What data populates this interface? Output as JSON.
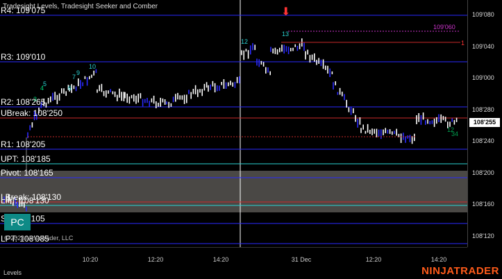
{
  "chart": {
    "indicator_title": "Tradesight Levels, Tradesight Seeker and Comber",
    "pc_label": "PC",
    "copyright": "© 2023 NinjaTrader, LLC",
    "last_price": "108'255"
  },
  "levels": [
    {
      "label": "R4: 109'075",
      "price": 109.235,
      "color": "#2a2aff"
    },
    {
      "label": "R3: 109'010",
      "price": 109.03,
      "color": "#2a2aff"
    },
    {
      "label": "R2: 108'265",
      "price": 108.828,
      "color": "#2a2aff"
    },
    {
      "label": "UBreak: 108'250",
      "price": 108.78,
      "color": "#cc2a2a"
    },
    {
      "label": "R1: 108'205",
      "price": 108.64,
      "color": "#2a2aff"
    },
    {
      "label": "UPT: 108'185",
      "price": 108.575,
      "color": "#2ad4d4"
    },
    {
      "label": "Pivot: 108'165",
      "price": 108.515,
      "color": "#2a2aff"
    },
    {
      "label": "LBreak: 108'130",
      "price": 108.405,
      "color": "#cc2a2a"
    },
    {
      "label": "LPT: 108'130",
      "price": 108.39,
      "color": "#2ad4d4"
    },
    {
      "label": "S1: 108'105",
      "price": 108.31,
      "color": "#2a2aff"
    },
    {
      "label": "LPT: 108'085",
      "price": 108.22,
      "color": "#2a2aff"
    }
  ],
  "price_axis": {
    "ticks": [
      "109'080",
      "109'040",
      "109'000",
      "108'280",
      "108'240",
      "108'200",
      "108'160",
      "108'120"
    ]
  },
  "time_axis": {
    "ticks": [
      "10:20",
      "12:20",
      "14:20",
      "31 Dec",
      "12:20",
      "14:20"
    ]
  },
  "annotations": {
    "target_label": "109'060",
    "target_price": 109.19,
    "target_marker": "1",
    "counts": [
      "3",
      "4",
      "5",
      "6",
      "7",
      "9",
      "10",
      "12",
      "13",
      "12",
      "34"
    ],
    "down_arrow": "⬇"
  },
  "footer": {
    "left_label": "Levels",
    "brand": "NINJATRADER"
  },
  "colors": {
    "background": "#000000",
    "bar_up": "#ffffff",
    "bar_down": "#2a2aff",
    "accent": "#ff5b1a",
    "zone_fill": "#4a4845"
  }
}
